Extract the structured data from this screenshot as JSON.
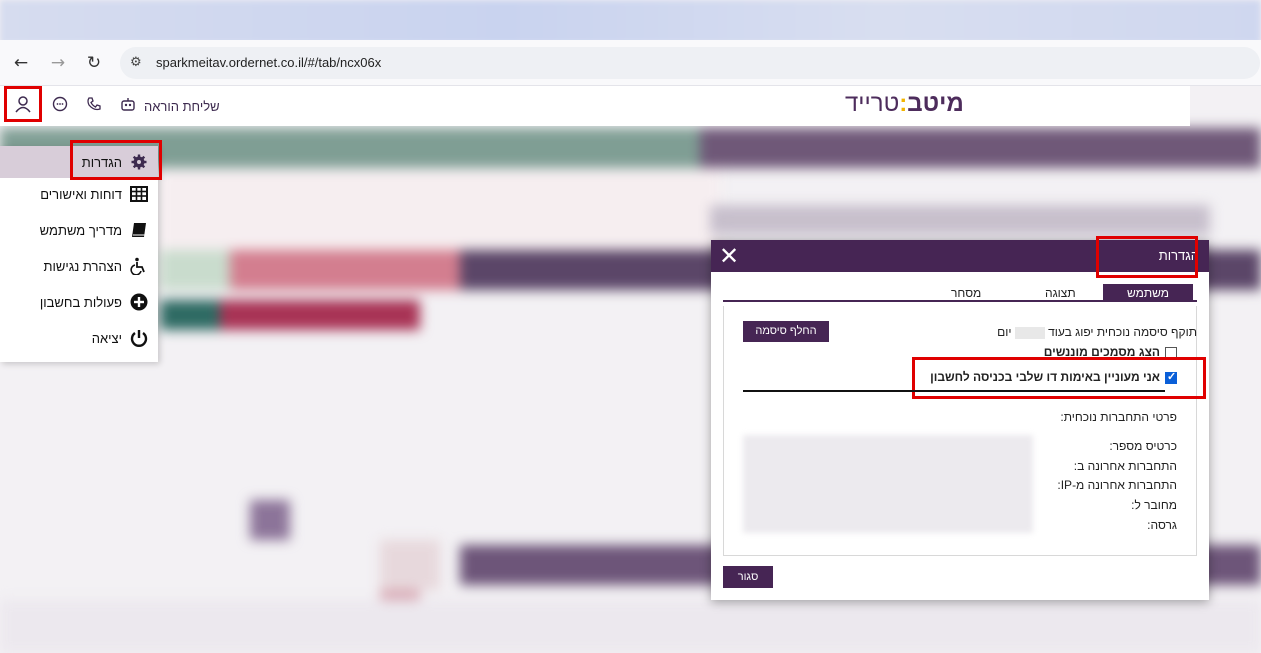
{
  "browser": {
    "url": "sparkmeitav.ordernet.co.il/#/tab/ncx06x",
    "back_icon": "←",
    "forward_icon": "→",
    "reload_icon": "↻",
    "site_settings_icon": "⚙"
  },
  "header": {
    "send_order_label": "שליחת הוראה",
    "logo_bold": "מיטב",
    "logo_colon": ":",
    "logo_light": "טרייד",
    "user_icon": "👤",
    "chat_icon": "💬",
    "phone_icon": "☏",
    "robot_icon": "🤖"
  },
  "side_menu": {
    "items": [
      {
        "label": "הגדרות",
        "icon": "⚙"
      },
      {
        "label": "דוחות ואישורים",
        "icon": "▦"
      },
      {
        "label": "מדריך משתמש",
        "icon": "📖"
      },
      {
        "label": "הצהרת נגישות",
        "icon": "♿"
      },
      {
        "label": "פעולות בחשבון",
        "icon": "⊕"
      },
      {
        "label": "יציאה",
        "icon": "⏻"
      }
    ]
  },
  "dialog": {
    "title": "הגדרות",
    "close_icon": "✕",
    "tabs": {
      "user": "משתמש",
      "display": "תצוגה",
      "trading": "מסחר"
    },
    "password_expiry_text": "תוקף סיסמה נוכחית יפוג בעוד",
    "password_expiry_unit": "יום",
    "change_password_button": "החלף סיסמה",
    "show_tickers_label": "הצג מסמכים מוננשים",
    "twofa_label": "אני מעוניין באימות דו שלבי בכניסה לחשבון",
    "current_connection_title": "פרטי התחברות נוכחית:",
    "fields": [
      "כרטיס מספר:",
      "התחברות אחרונה ב:",
      "התחברות אחרונה מ-IP:",
      "מחובר ל:",
      "גרסה:"
    ],
    "close_button": "סגור"
  }
}
